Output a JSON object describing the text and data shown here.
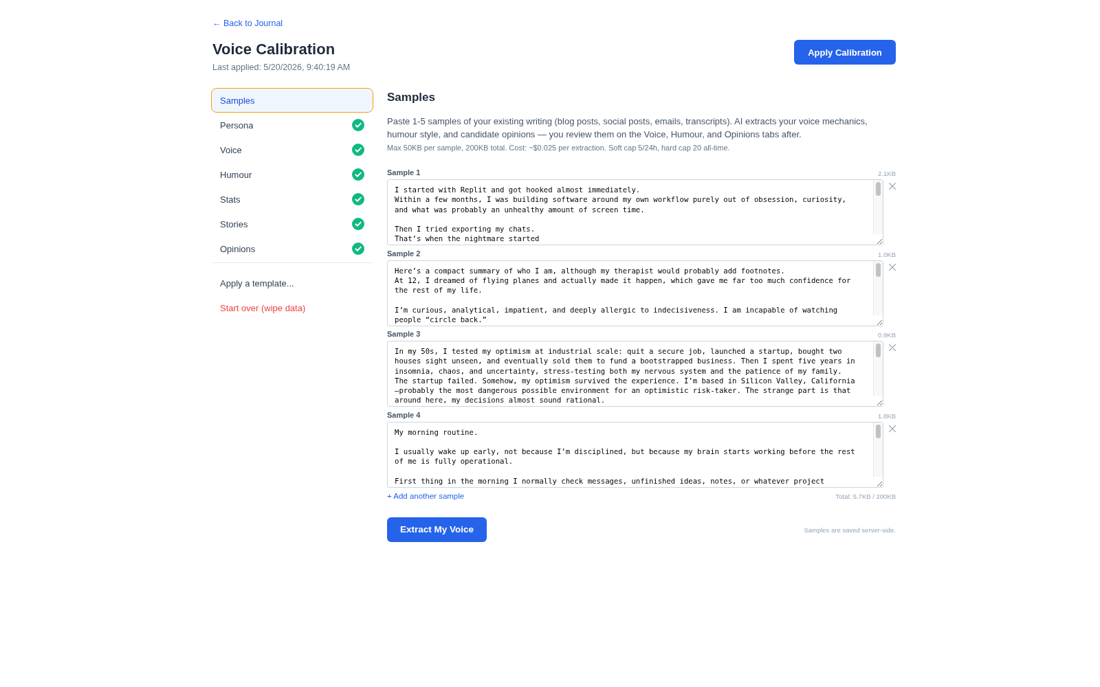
{
  "back_link": "← Back to Journal",
  "header": {
    "title": "Voice Calibration",
    "subtitle": "Last applied: 5/20/2026, 9:40:19 AM",
    "apply_button": "Apply Calibration"
  },
  "sidebar": {
    "steps": [
      {
        "label": "Samples",
        "selected": true,
        "done": false
      },
      {
        "label": "Persona",
        "selected": false,
        "done": true
      },
      {
        "label": "Voice",
        "selected": false,
        "done": true
      },
      {
        "label": "Humour",
        "selected": false,
        "done": true
      },
      {
        "label": "Stats",
        "selected": false,
        "done": true
      },
      {
        "label": "Stories",
        "selected": false,
        "done": true
      },
      {
        "label": "Opinions",
        "selected": false,
        "done": true
      }
    ],
    "actions": [
      {
        "label": "Apply a template...",
        "kind": "neutral"
      },
      {
        "label": "Start over (wipe data)",
        "kind": "danger"
      }
    ]
  },
  "panel": {
    "heading": "Samples",
    "description": "Paste 1-5 samples of your existing writing (blog posts, social posts, emails, transcripts). AI extracts your voice mechanics, humour style, and candidate opinions — you review them on the Voice, Humour, and Opinions tabs after.",
    "note": "Max 50KB per sample, 200KB total. Cost: ~$0.025 per extraction. Soft cap 5/24h, hard cap 20 all-time.",
    "samples": [
      {
        "label": "Sample 1",
        "size": "2.1KB",
        "text": "I started with Replit and got hooked almost immediately.\nWithin a few months, I was building software around my own workflow purely out of obsession, curiosity,\nand what was probably an unhealthy amount of screen time.\n\nThen I tried exporting my chats.\nThat’s when the nightmare started"
      },
      {
        "label": "Sample 2",
        "size": "1.0KB",
        "text": "Here’s a compact summary of who I am, although my therapist would probably add footnotes.\nAt 12, I dreamed of flying planes and actually made it happen, which gave me far too much confidence for\nthe rest of my life.\n\nI’m curious, analytical, impatient, and deeply allergic to indecisiveness. I am incapable of watching\npeople “circle back.”"
      },
      {
        "label": "Sample 3",
        "size": "0.9KB",
        "text": "In my 50s, I tested my optimism at industrial scale: quit a secure job, launched a startup, bought two\nhouses sight unseen, and eventually sold them to fund a bootstrapped business. Then I spent five years in\ninsomnia, chaos, and uncertainty, stress-testing both my nervous system and the patience of my family.\nThe startup failed. Somehow, my optimism survived the experience. I’m based in Silicon Valley, California\n—probably the most dangerous possible environment for an optimistic risk-taker. The strange part is that\naround here, my decisions almost sound rational."
      },
      {
        "label": "Sample 4",
        "size": "1.8KB",
        "text": "My morning routine.\n\nI usually wake up early, not because I’m disciplined, but because my brain starts working before the rest\nof me is fully operational.\n\nFirst thing in the morning I normally check messages, unfinished ideas, notes, or whatever project"
      }
    ],
    "add_link": "+ Add another sample",
    "total": "Total: 5.7KB / 200KB",
    "extract_button": "Extract My Voice",
    "footer_note": "Samples are saved server-side."
  }
}
